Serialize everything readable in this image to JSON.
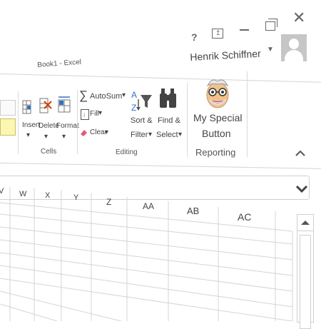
{
  "window": {
    "title": "Book1 - Excel",
    "help": "?",
    "ribbon_display": "▣",
    "minimize": "—",
    "restore": "❐",
    "close": "✕"
  },
  "user": {
    "name": "Henrik Schiffner",
    "caret": "▼"
  },
  "ribbon": {
    "cells": {
      "label": "Cells",
      "insert": "Insert",
      "delete": "Delete",
      "format": "Format",
      "dropdown": "▾"
    },
    "editing": {
      "label": "Editing",
      "autosum": "AutoSum",
      "fill": "Fill",
      "clear": "Clear",
      "sort_line1": "Sort &",
      "sort_line2": "Filter",
      "find_line1": "Find &",
      "find_line2": "Select",
      "dropdown": "▾"
    },
    "reporting": {
      "label": "Reporting",
      "button_line1": "My Special",
      "button_line2": "Button"
    },
    "collapse": "^"
  },
  "formula_bar": {
    "expand": "⌄"
  },
  "columns": [
    "W",
    "X",
    "Y",
    "Z",
    "AA",
    "AB",
    "AC"
  ],
  "scrollbar": {
    "up": "▲"
  }
}
